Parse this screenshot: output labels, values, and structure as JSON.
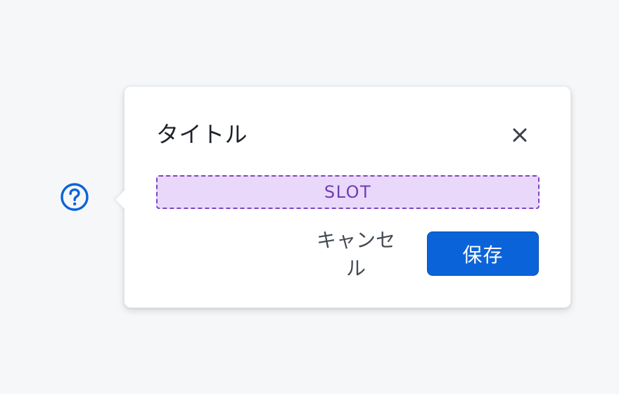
{
  "help": {
    "icon": "question-circle-icon",
    "color": "#0b63d9"
  },
  "popover": {
    "title": "タイトル",
    "close_icon": "close-icon",
    "slot_label": "SLOT",
    "cancel_label": "キャンセル",
    "save_label": "保存"
  },
  "colors": {
    "primary": "#0b63d9",
    "slot_background": "#ead8fb",
    "slot_border": "#7b45c2",
    "page_background": "#f6f7f9"
  }
}
